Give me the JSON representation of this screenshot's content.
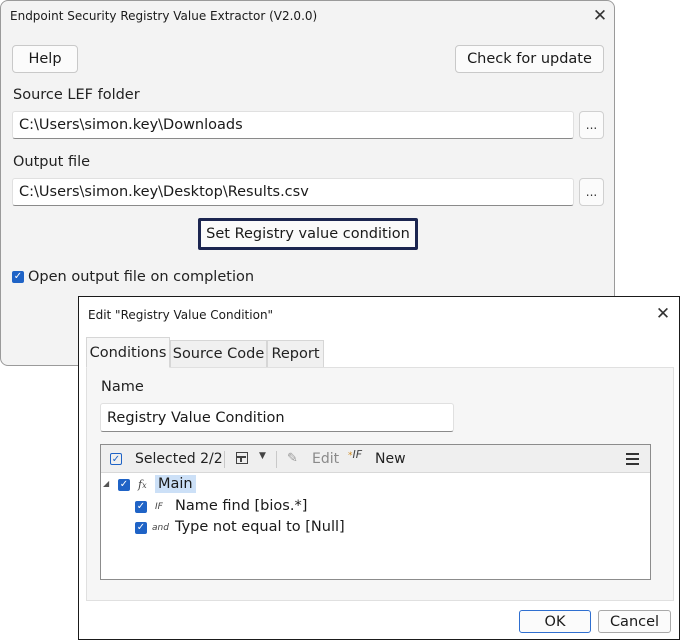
{
  "main_window": {
    "title": "Endpoint Security Registry Value Extractor (V2.0.0)",
    "close_glyph": "✕",
    "help_label": "Help",
    "check_update_label": "Check for update",
    "source_label": "Source LEF folder",
    "source_value": "C:\\Users\\simon.key\\Downloads",
    "output_label": "Output file",
    "output_value": "C:\\Users\\simon.key\\Desktop\\Results.csv",
    "browse_label": "...",
    "set_condition_label": "Set Registry value condition",
    "open_on_completion_label": "Open output file on completion",
    "open_on_completion_checked": true
  },
  "dialog": {
    "title": "Edit \"Registry Value Condition\"",
    "close_glyph": "✕",
    "tabs": [
      {
        "label": "Conditions",
        "active": true
      },
      {
        "label": "Source Code",
        "active": false
      },
      {
        "label": "Report",
        "active": false
      }
    ],
    "name_label": "Name",
    "name_value": "Registry Value Condition",
    "toolbar": {
      "selected_label": "Selected 2/2",
      "edit_label": "Edit",
      "new_label": "New"
    },
    "tree": [
      {
        "label": "Main",
        "icon": "function-icon",
        "icon_text": "fx",
        "checked": true,
        "level": 0
      },
      {
        "label": "Name find [bios.*]",
        "icon": "if-icon",
        "icon_text": "IF",
        "checked": true,
        "level": 1
      },
      {
        "label": "Type not equal to [Null]",
        "icon": "and-icon",
        "icon_text": "and",
        "checked": true,
        "level": 1
      }
    ],
    "ok_label": "OK",
    "cancel_label": "Cancel"
  },
  "colors": {
    "accent": "#1f63c6",
    "focus_border": "#1b2550",
    "selection": "#cce0f7"
  }
}
